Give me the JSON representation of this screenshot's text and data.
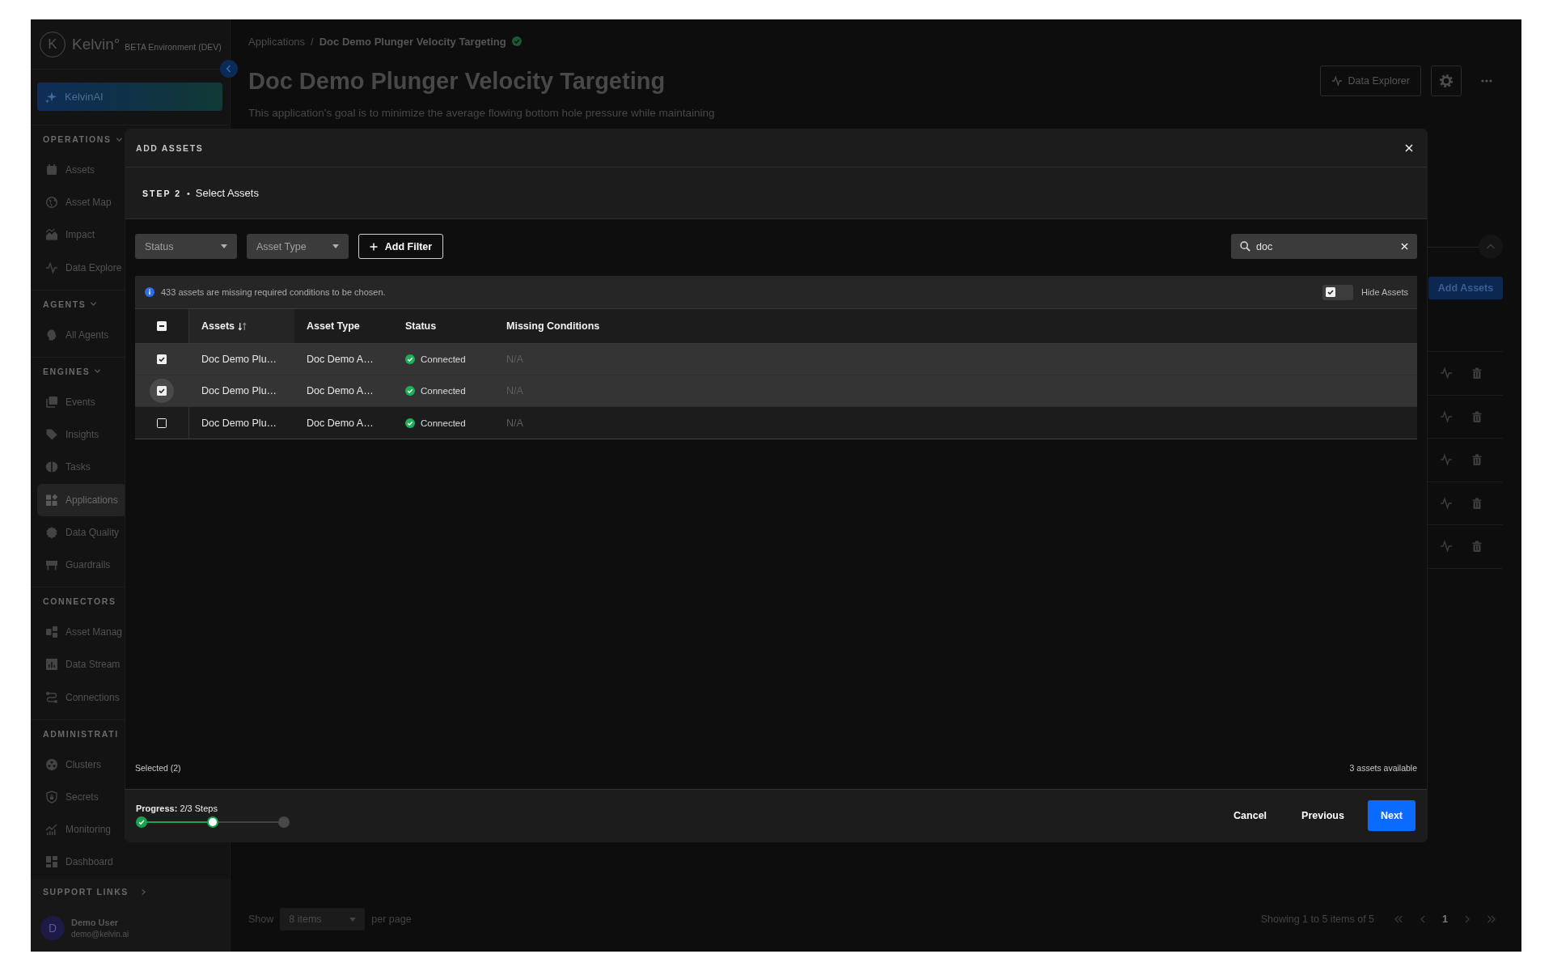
{
  "sidebar": {
    "logo": {
      "mark": "K",
      "name": "Kelvin°",
      "environment": "BETA Environment (DEV)"
    },
    "ai_button": "KelvinAI",
    "sections": [
      {
        "heading": "OPERATIONS",
        "expanded": true,
        "items": [
          {
            "label": "Assets",
            "selected": false
          },
          {
            "label": "Asset Map",
            "selected": false
          },
          {
            "label": "Impact",
            "selected": false
          },
          {
            "label": "Data Explore",
            "selected": false
          }
        ]
      },
      {
        "heading": "AGENTS",
        "expanded": true,
        "items": [
          {
            "label": "All Agents",
            "selected": false
          }
        ]
      },
      {
        "heading": "ENGINES",
        "expanded": true,
        "items": [
          {
            "label": "Events",
            "selected": false
          },
          {
            "label": "Insights",
            "selected": false
          },
          {
            "label": "Tasks",
            "selected": false
          },
          {
            "label": "Applications",
            "selected": true
          },
          {
            "label": "Data Quality",
            "selected": false
          },
          {
            "label": "Guardrails",
            "selected": false
          }
        ]
      },
      {
        "heading": "CONNECTORS",
        "items": [
          {
            "label": "Asset Manag",
            "selected": false
          },
          {
            "label": "Data Stream",
            "selected": false
          },
          {
            "label": "Connections",
            "selected": false
          }
        ]
      },
      {
        "heading": "ADMINISTRATI",
        "items": [
          {
            "label": "Clusters",
            "selected": false
          },
          {
            "label": "Secrets",
            "selected": false
          },
          {
            "label": "Monitoring",
            "selected": false
          },
          {
            "label": "Dashboard",
            "selected": false
          }
        ]
      }
    ],
    "support_links": "SUPPORT LINKS",
    "user": {
      "initial": "D",
      "name": "Demo User",
      "email": "demo@kelvin.ai"
    }
  },
  "main": {
    "breadcrumb": {
      "parent": "Applications",
      "separator": "/",
      "current": "Doc Demo Plunger Velocity Targeting"
    },
    "title": "Doc Demo Plunger Velocity Targeting",
    "description": "This application's goal is to minimize the average flowing bottom hole pressure while maintaining",
    "actions": {
      "data_explorer": "Data Explorer"
    },
    "add_assets": "Add Assets",
    "pagination": {
      "show": "Show",
      "page_size": "8 items",
      "per_page": "per page",
      "summary": "Showing 1 to 5 items of 5",
      "pages": [
        {
          "label": "1",
          "selected": true
        }
      ]
    }
  },
  "modal": {
    "title": "ADD ASSETS",
    "step": {
      "label": "STEP 2",
      "separator": "•",
      "title": "Select Assets"
    },
    "filters": [
      {
        "label": "Status"
      },
      {
        "label": "Asset Type"
      }
    ],
    "add_filter": "Add Filter",
    "search": {
      "value": "doc"
    },
    "notice": "433 assets are missing required conditions to be chosen.",
    "hide_assets": {
      "label": "Hide Assets",
      "checked": true
    },
    "table": {
      "select_all": {
        "checked": true,
        "partial": true
      },
      "columns": [
        {
          "label": "Assets",
          "sorted": true
        },
        {
          "label": "Asset Type",
          "sorted": false
        },
        {
          "label": "Status",
          "sorted": false
        },
        {
          "label": "Missing Conditions",
          "sorted": false
        }
      ],
      "rows": [
        {
          "selected": true,
          "focused": false,
          "asset": "Doc Demo Plu…",
          "asset_type": "Doc Demo A…",
          "status": "Connected",
          "missing_conditions": "N/A"
        },
        {
          "selected": true,
          "focused": true,
          "asset": "Doc Demo Plu…",
          "asset_type": "Doc Demo A…",
          "status": "Connected",
          "missing_conditions": "N/A"
        },
        {
          "selected": false,
          "focused": false,
          "asset": "Doc Demo Plu…",
          "asset_type": "Doc Demo A…",
          "status": "Connected",
          "missing_conditions": "N/A"
        }
      ]
    },
    "selected_count": "Selected (2)",
    "available_count": "3 assets available",
    "progress": {
      "text": "**Progress:** 2/3 Steps",
      "steps": [
        {
          "completed": true,
          "current": false
        },
        {
          "completed": false,
          "current": true
        },
        {
          "completed": false,
          "current": false
        }
      ]
    },
    "buttons": [
      {
        "label": "Cancel",
        "kind": "text"
      },
      {
        "label": "Previous",
        "kind": "text"
      },
      {
        "label": "Next",
        "kind": "primary"
      }
    ]
  }
}
